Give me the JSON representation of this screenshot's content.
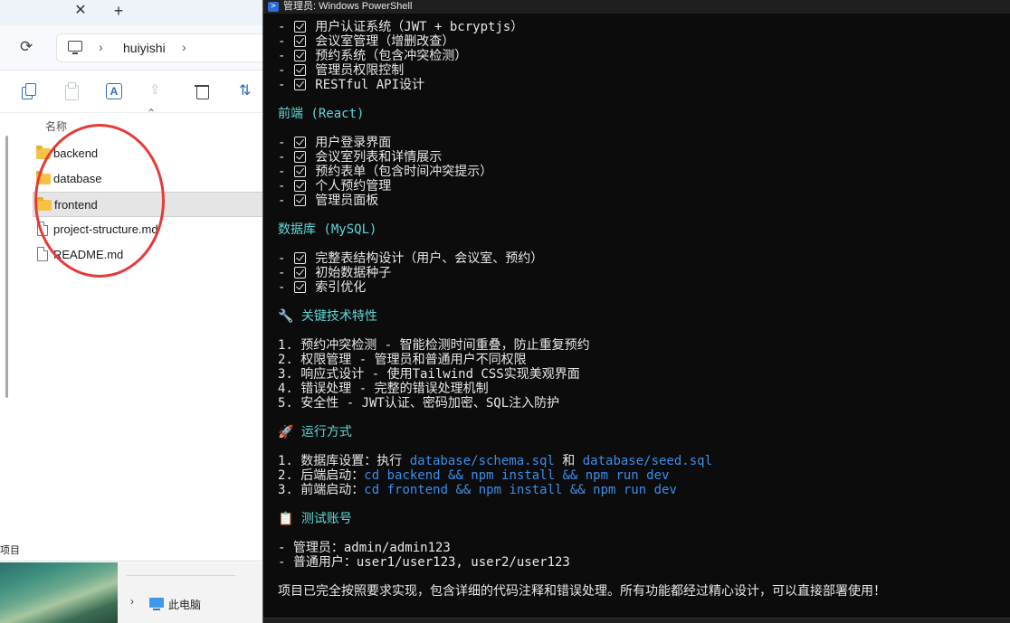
{
  "explorer": {
    "tab_close": "✕",
    "tab_new": "+",
    "breadcrumb": {
      "folder": "huiyishi"
    },
    "column_header": "名称",
    "files": [
      {
        "name": "backend",
        "type": "folder",
        "selected": false
      },
      {
        "name": "database",
        "type": "folder",
        "selected": false
      },
      {
        "name": "frontend",
        "type": "folder",
        "selected": true
      },
      {
        "name": "project-structure.md",
        "type": "file",
        "selected": false
      },
      {
        "name": "README.md",
        "type": "file",
        "selected": false
      }
    ],
    "status_text": "项目",
    "nav_pane": {
      "this_pc": "此电脑"
    },
    "highlight_color": "#e63a3a"
  },
  "powershell": {
    "title": "管理员: Windows PowerShell",
    "backend_items": [
      "用户认证系统（JWT + bcryptjs）",
      "会议室管理（增删改查）",
      "预约系统（包含冲突检测）",
      "管理员权限控制",
      "RESTful API设计"
    ],
    "frontend_heading": "前端 (React)",
    "frontend_items": [
      "用户登录界面",
      "会议室列表和详情展示",
      "预约表单（包含时间冲突提示）",
      "个人预约管理",
      "管理员面板"
    ],
    "db_heading": "数据库 (MySQL)",
    "db_items": [
      "完整表结构设计（用户、会议室、预约）",
      "初始数据种子",
      "索引优化"
    ],
    "features_heading": "关键技术特性",
    "features": [
      "1. 预约冲突检测 - 智能检测时间重叠，防止重复预约",
      "2. 权限管理 - 管理员和普通用户不同权限",
      "3. 响应式设计 - 使用Tailwind CSS实现美观界面",
      "4. 错误处理 - 完整的错误处理机制",
      "5. 安全性 - JWT认证、密码加密、SQL注入防护"
    ],
    "run_heading": "运行方式",
    "run_steps": [
      {
        "prefix": "1. 数据库设置：执行 ",
        "code1": "database/schema.sql",
        "mid": " 和 ",
        "code2": "database/seed.sql"
      },
      {
        "prefix": "2. 后端启动：",
        "code1": "cd backend && npm install && npm run dev"
      },
      {
        "prefix": "3. 前端启动：",
        "code1": "cd frontend && npm install && npm run dev"
      }
    ],
    "accounts_heading": "测试账号",
    "accounts": [
      "- 管理员：admin/admin123",
      "- 普通用户：user1/user123, user2/user123"
    ],
    "summary": "项目已完全按照要求实现，包含详细的代码注释和错误处理。所有功能都经过精心设计，可以直接部署使用！",
    "colors": {
      "heading": "#61d6d6",
      "command": "#3b8eea",
      "text": "#e8e8e8",
      "background": "#0c0c0c"
    }
  }
}
